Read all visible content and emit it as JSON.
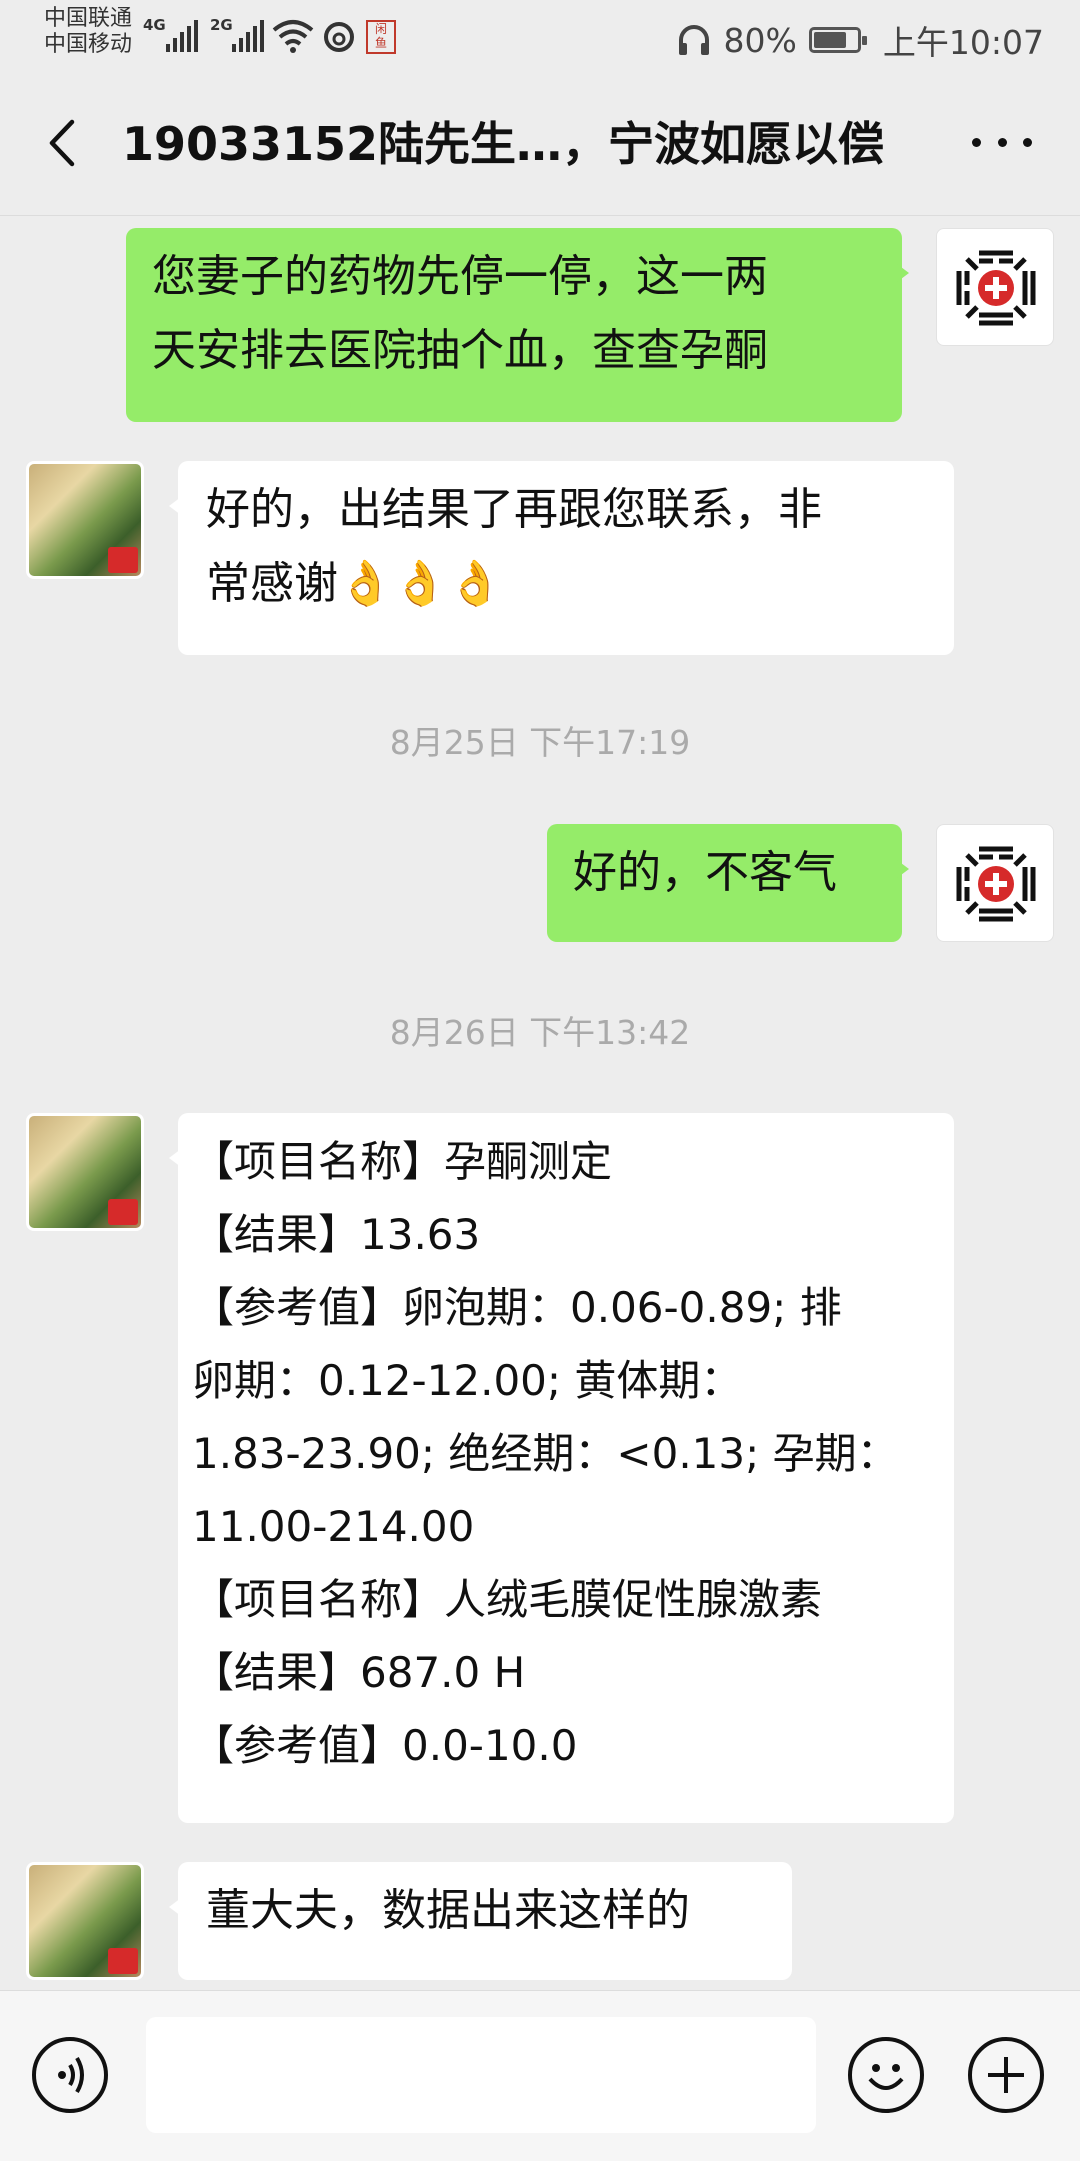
{
  "status_bar": {
    "carrier_1": "中国联通",
    "carrier_2": "中国移动",
    "sim1_network": "4G",
    "sim2_network": "2G",
    "battery_percent": "80%",
    "battery_level": 0.8,
    "time": "上午10:07"
  },
  "header": {
    "title": "19033152陆先生…，宁波如愿以偿"
  },
  "messages": [
    {
      "direction": "out",
      "lines": [
        "您妻子的药物先停一停，这一两",
        "天安排去医院抽个血，查查孕酮"
      ]
    },
    {
      "direction": "in",
      "lines": [
        "好的，出结果了再跟您联系，非",
        "常感谢👌👌👌"
      ]
    },
    {
      "type": "time",
      "text": "8月25日 下午17:19"
    },
    {
      "direction": "out",
      "lines": [
        "好的，不客气"
      ]
    },
    {
      "type": "time",
      "text": "8月26日 下午13:42"
    },
    {
      "direction": "in",
      "lines": [
        "【项目名称】孕酮测定",
        "【结果】13.63",
        "【参考值】卵泡期：0.06-0.89; 排",
        "卵期：0.12-12.00; 黄体期：",
        "1.83-23.90; 绝经期：<0.13; 孕期：",
        "11.00-214.00",
        "【项目名称】人绒毛膜促性腺激素",
        "【结果】687.0 H",
        "【参考值】0.0-10.0"
      ]
    },
    {
      "direction": "in",
      "lines": [
        "董大夫，数据出来这样的"
      ]
    }
  ],
  "input_bar": {
    "voice_icon": "voice-icon",
    "emoji_icon": "emoji-icon",
    "add_icon": "plus-icon"
  },
  "colors": {
    "outgoing_bubble": "#95EC69",
    "incoming_bubble": "#FFFFFF",
    "background": "#EDEDED",
    "timestamp_text": "#AAAAAA"
  }
}
